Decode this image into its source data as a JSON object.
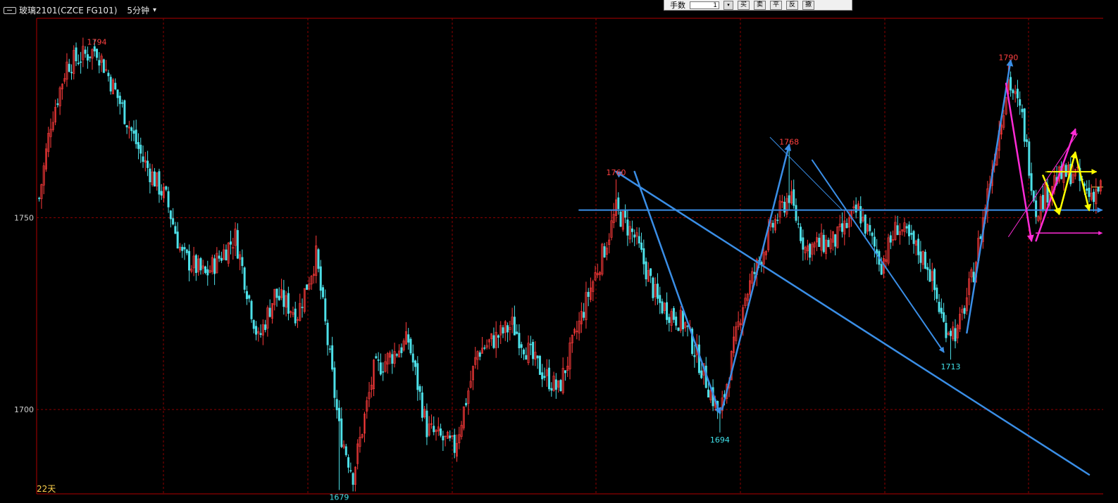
{
  "header": {
    "symbol": "玻璃2101(CZCE FG101)",
    "interval": "5分钟"
  },
  "trade_panel": {
    "qty_label": "手数",
    "qty_value": "1",
    "buttons": [
      "买",
      "卖",
      "平",
      "反",
      "撤"
    ]
  },
  "footer": {
    "days": "22天"
  },
  "colors": {
    "up": "#ff3b3b",
    "down": "#4de0e8",
    "grid": "#8b0000",
    "blue_line": "#3a8ee6",
    "magenta_line": "#ff2bd6",
    "yellow_line": "#ffff00",
    "high_label": "#ff4040",
    "low_label": "#40e0e8"
  },
  "chart_data": {
    "type": "candlestick",
    "ylim": [
      1678,
      1802
    ],
    "yticks": [
      1700,
      1750
    ],
    "annotations": [
      {
        "text": "1794",
        "kind": "high",
        "bar": 25
      },
      {
        "text": "1679",
        "kind": "low",
        "bar": 130
      },
      {
        "text": "1760",
        "kind": "high",
        "bar": 250
      },
      {
        "text": "1694",
        "kind": "low",
        "bar": 295
      },
      {
        "text": "1768",
        "kind": "high",
        "bar": 325
      },
      {
        "text": "1713",
        "kind": "low",
        "bar": 395
      },
      {
        "text": "1790",
        "kind": "high",
        "bar": 420
      }
    ],
    "anchors": [
      [
        0,
        1755
      ],
      [
        5,
        1775
      ],
      [
        12,
        1790
      ],
      [
        25,
        1794
      ],
      [
        35,
        1780
      ],
      [
        45,
        1765
      ],
      [
        55,
        1755
      ],
      [
        62,
        1740
      ],
      [
        72,
        1735
      ],
      [
        85,
        1745
      ],
      [
        95,
        1718
      ],
      [
        102,
        1730
      ],
      [
        112,
        1725
      ],
      [
        120,
        1740
      ],
      [
        130,
        1695
      ],
      [
        136,
        1683
      ],
      [
        145,
        1710
      ],
      [
        160,
        1718
      ],
      [
        168,
        1695
      ],
      [
        180,
        1690
      ],
      [
        190,
        1715
      ],
      [
        205,
        1722
      ],
      [
        215,
        1712
      ],
      [
        225,
        1705
      ],
      [
        238,
        1730
      ],
      [
        245,
        1742
      ],
      [
        250,
        1752
      ],
      [
        258,
        1745
      ],
      [
        268,
        1728
      ],
      [
        280,
        1722
      ],
      [
        295,
        1698
      ],
      [
        305,
        1728
      ],
      [
        318,
        1748
      ],
      [
        325,
        1756
      ],
      [
        332,
        1742
      ],
      [
        345,
        1744
      ],
      [
        355,
        1752
      ],
      [
        365,
        1738
      ],
      [
        372,
        1748
      ],
      [
        385,
        1738
      ],
      [
        392,
        1722
      ],
      [
        398,
        1720
      ],
      [
        405,
        1736
      ],
      [
        412,
        1760
      ],
      [
        420,
        1786
      ],
      [
        426,
        1776
      ],
      [
        432,
        1752
      ],
      [
        440,
        1760
      ],
      [
        448,
        1762
      ],
      [
        455,
        1756
      ],
      [
        460,
        1758
      ]
    ],
    "bars_count": 461,
    "drawn_lines": [
      {
        "color": "blue",
        "from": [
          455,
          1683
        ],
        "to": [
          250,
          1762
        ],
        "arrow": true,
        "width": 2.5
      },
      {
        "color": "blue",
        "from": [
          250,
          1762
        ],
        "to": [
          295,
          1699
        ],
        "arrow": true,
        "width": 2.5,
        "start_bar": 258
      },
      {
        "color": "blue",
        "from": [
          296,
          1700
        ],
        "to": [
          325,
          1769
        ],
        "arrow": true,
        "width": 2.5
      },
      {
        "color": "blue",
        "from": [
          335,
          1765
        ],
        "to": [
          392,
          1715
        ],
        "arrow": true,
        "width": 2.0
      },
      {
        "color": "blue",
        "from": [
          402,
          1720
        ],
        "to": [
          421,
          1791
        ],
        "arrow": true,
        "width": 2.5
      },
      {
        "color": "blue",
        "from": [
          234,
          1752
        ],
        "to": [
          460,
          1752
        ],
        "arrow": true,
        "width": 2.0,
        "horizontal": true
      },
      {
        "color": "magenta",
        "from": [
          419,
          1785
        ],
        "to": [
          430,
          1744
        ],
        "arrow": true,
        "width": 2.5
      },
      {
        "color": "magenta",
        "from": [
          432,
          1746
        ],
        "to": [
          460,
          1746
        ],
        "arrow": true,
        "width": 1.5,
        "horizontal": true
      },
      {
        "color": "magenta",
        "from": [
          432,
          1744
        ],
        "to": [
          449,
          1773
        ],
        "arrow": true,
        "width": 2.5
      },
      {
        "color": "yellow",
        "from": [
          435,
          1761
        ],
        "to": [
          442,
          1751
        ],
        "arrow": true,
        "width": 2.5
      },
      {
        "color": "yellow",
        "from": [
          442,
          1751
        ],
        "to": [
          449,
          1767
        ],
        "arrow": true,
        "width": 2.5
      },
      {
        "color": "yellow",
        "from": [
          449,
          1767
        ],
        "to": [
          455,
          1752
        ],
        "arrow": true,
        "width": 2.5
      },
      {
        "color": "yellow",
        "from": [
          437,
          1762
        ],
        "to": [
          458,
          1762
        ],
        "arrow": true,
        "width": 2.0,
        "horizontal": true
      }
    ]
  }
}
